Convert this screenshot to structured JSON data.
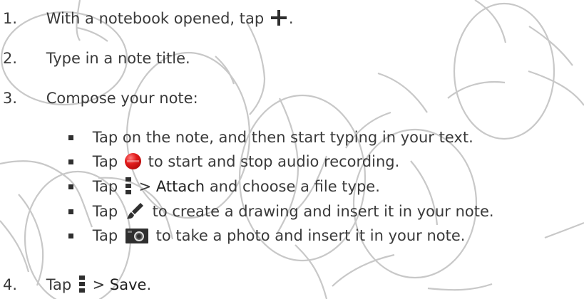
{
  "instructions": {
    "steps": [
      {
        "number": "1.",
        "before": "With a notebook opened, tap",
        "after": "."
      },
      {
        "number": "2.",
        "text": "Type in a note title."
      },
      {
        "number": "3.",
        "text": "Compose your note:"
      },
      {
        "number": "4.",
        "before": "Tap",
        "separator": ">",
        "action": "Save",
        "after": "."
      }
    ],
    "bullets": [
      {
        "text": "Tap on the note, and then start typing in your text."
      },
      {
        "before": "Tap",
        "after": "to start and stop audio recording."
      },
      {
        "before": "Tap",
        "separator": ">",
        "action": "Attach",
        "after": "and choose a file type."
      },
      {
        "before": "Tap",
        "after": "to create a drawing and insert it in your note."
      },
      {
        "before": "Tap",
        "after": "to take a photo and insert it in your note."
      }
    ]
  },
  "icons": {
    "add": "plus-icon",
    "record": "record-icon",
    "menu": "menu-icon",
    "draw": "brush-icon",
    "camera": "camera-icon"
  },
  "colors": {
    "text": "#3a3a3a",
    "record": "#e21c1c",
    "watermark": "#c8c8c8"
  }
}
